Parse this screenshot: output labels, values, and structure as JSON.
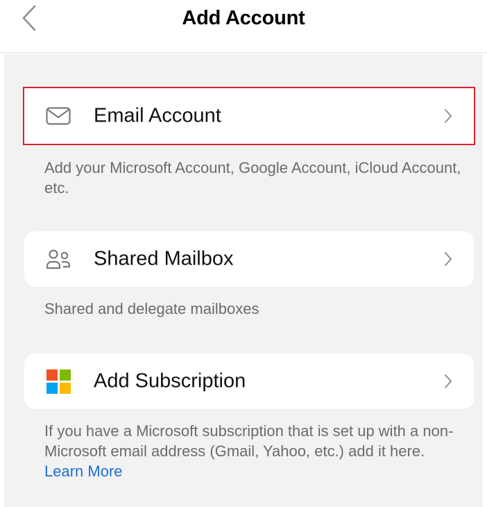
{
  "nav": {
    "title": "Add Account",
    "back_icon": "chevron-left-icon"
  },
  "options": [
    {
      "label": "Email Account",
      "icon": "envelope-icon",
      "description": "Add your Microsoft Account, Google Account, iCloud Account, etc.",
      "highlighted": true
    },
    {
      "label": "Shared Mailbox",
      "icon": "people-icon",
      "description": "Shared and delegate mailboxes"
    },
    {
      "label": "Add Subscription",
      "icon": "microsoft-logo-icon",
      "description": "If you have a Microsoft subscription that is set up with a non-Microsoft email address (Gmail, Yahoo, etc.) add it here.",
      "link": "Learn More"
    }
  ],
  "colors": {
    "background": "#f2f2f2",
    "card": "#ffffff",
    "highlight_border": "#dc1f30",
    "link": "#1a6fd1",
    "secondary_text": "#6b6b70",
    "ms_red": "#f25022",
    "ms_green": "#7fba00",
    "ms_blue": "#00a4ef",
    "ms_yellow": "#ffb900"
  }
}
